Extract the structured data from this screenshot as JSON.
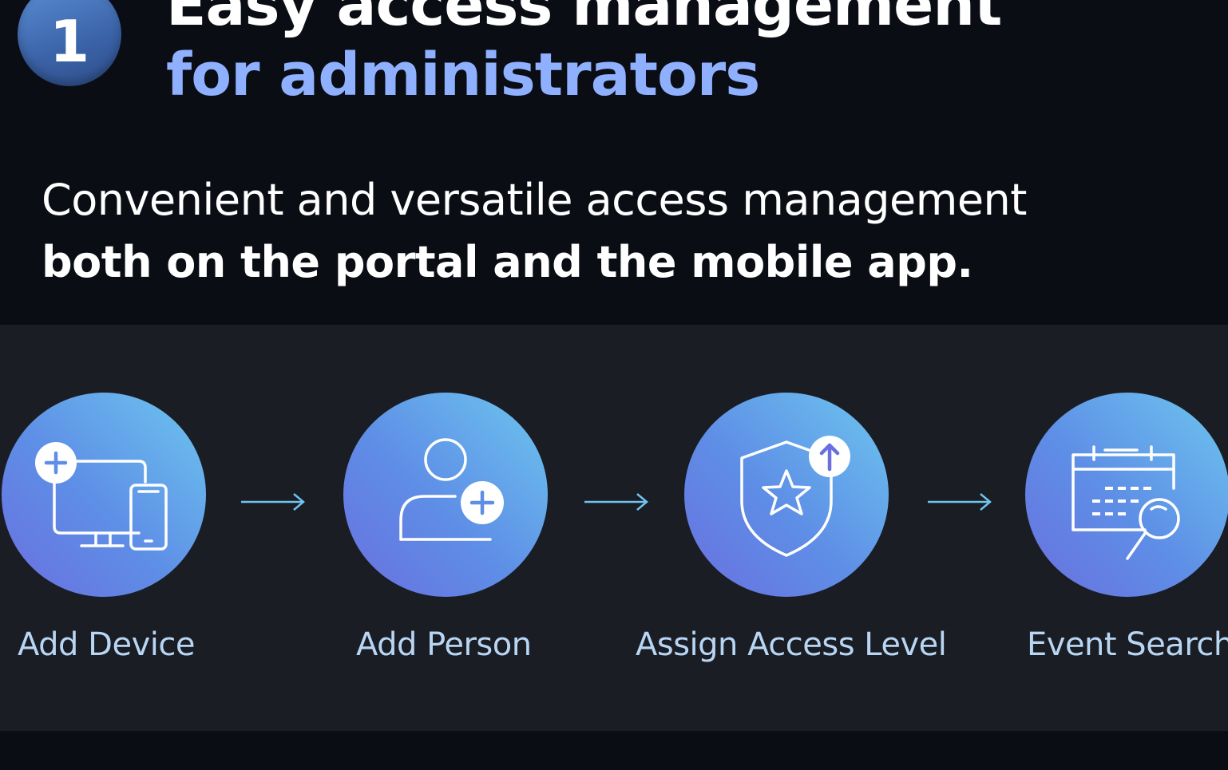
{
  "header": {
    "step_number": "1",
    "title_line1": "Easy access management",
    "title_line2": "for administrators"
  },
  "subtitle": {
    "line1": "Convenient and versatile access management",
    "line2": "both on the portal and the mobile app."
  },
  "steps": [
    {
      "label": "Add Device",
      "icon": "device-add-icon"
    },
    {
      "label": "Add Person",
      "icon": "person-add-icon"
    },
    {
      "label": "Assign Access Level",
      "icon": "shield-star-icon"
    },
    {
      "label": "Event Search",
      "icon": "calendar-search-icon"
    }
  ],
  "colors": {
    "background": "#0a0d14",
    "panel": "#1a1d24",
    "title_accent": "#8fb0ff",
    "label": "#b8d6f4",
    "arrow": "#6fc3ee"
  }
}
